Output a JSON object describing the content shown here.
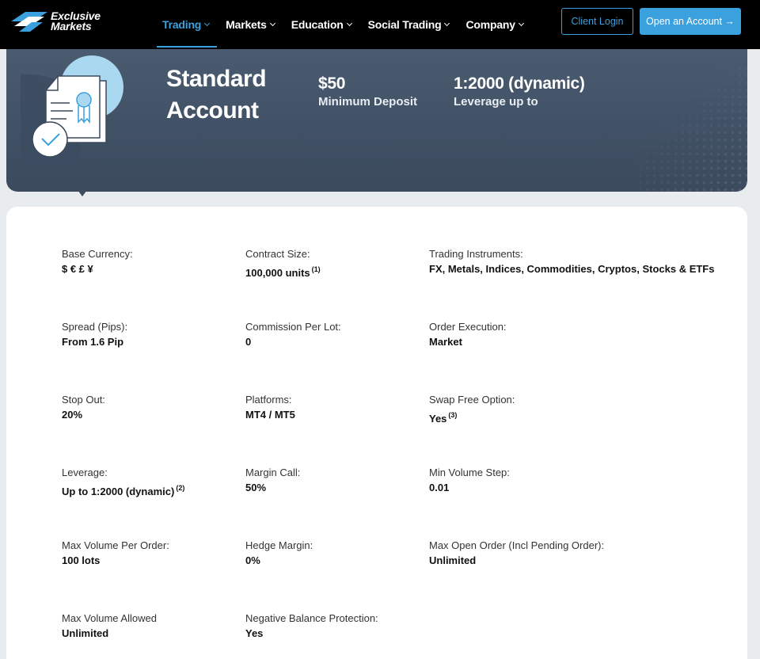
{
  "nav": {
    "logo_line1": "Exclusive",
    "logo_line2": "Markets",
    "items": [
      {
        "label": "Trading",
        "active": true
      },
      {
        "label": "Markets"
      },
      {
        "label": "Education"
      },
      {
        "label": "Social Trading"
      },
      {
        "label": "Company"
      }
    ],
    "login_label": "Client Login",
    "open_label": "Open an Account →"
  },
  "colors": {
    "accent": "#3aa0de",
    "hero_bg": "#46576b",
    "nav_bg": "#000000"
  },
  "hero": {
    "title_line1": "Standard",
    "title_line2": "Account",
    "deposit_value": "$50",
    "deposit_label": "Minimum Deposit",
    "leverage_value": "1:2000 (dynamic)",
    "leverage_label": "Leverage up to"
  },
  "specs": [
    {
      "key": "Base Currency:",
      "value": "$ € £ ¥"
    },
    {
      "key": "Contract Size:",
      "value": "100,000 units",
      "note": "(1)"
    },
    {
      "key": "Trading Instruments:",
      "value": "FX, Metals, Indices, Commodities, Cryptos, Stocks & ETFs"
    },
    {
      "key": "Spread (Pips):",
      "value": "From 1.6 Pip"
    },
    {
      "key": "Commission Per Lot:",
      "value": "0"
    },
    {
      "key": "Order Execution:",
      "value": "Market"
    },
    {
      "key": "Stop Out:",
      "value": "20%"
    },
    {
      "key": "Platforms:",
      "value": "MT4 / MT5"
    },
    {
      "key": "Swap Free Option:",
      "value": "Yes",
      "note": "(3)"
    },
    {
      "key": "Leverage:",
      "value": "Up to 1:2000 (dynamic)",
      "note": "(2)"
    },
    {
      "key": "Margin Call:",
      "value": "50%"
    },
    {
      "key": "Min Volume Step:",
      "value": "0.01"
    },
    {
      "key": "Max Volume Per Order:",
      "value": "100 lots"
    },
    {
      "key": "Hedge Margin:",
      "value": "0%"
    },
    {
      "key": "Max Open Order (Incl Pending Order):",
      "value": "Unlimited"
    },
    {
      "key": "Max Volume Allowed",
      "value": "Unlimited"
    },
    {
      "key": "Negative Balance Protection:",
      "value": "Yes"
    }
  ]
}
